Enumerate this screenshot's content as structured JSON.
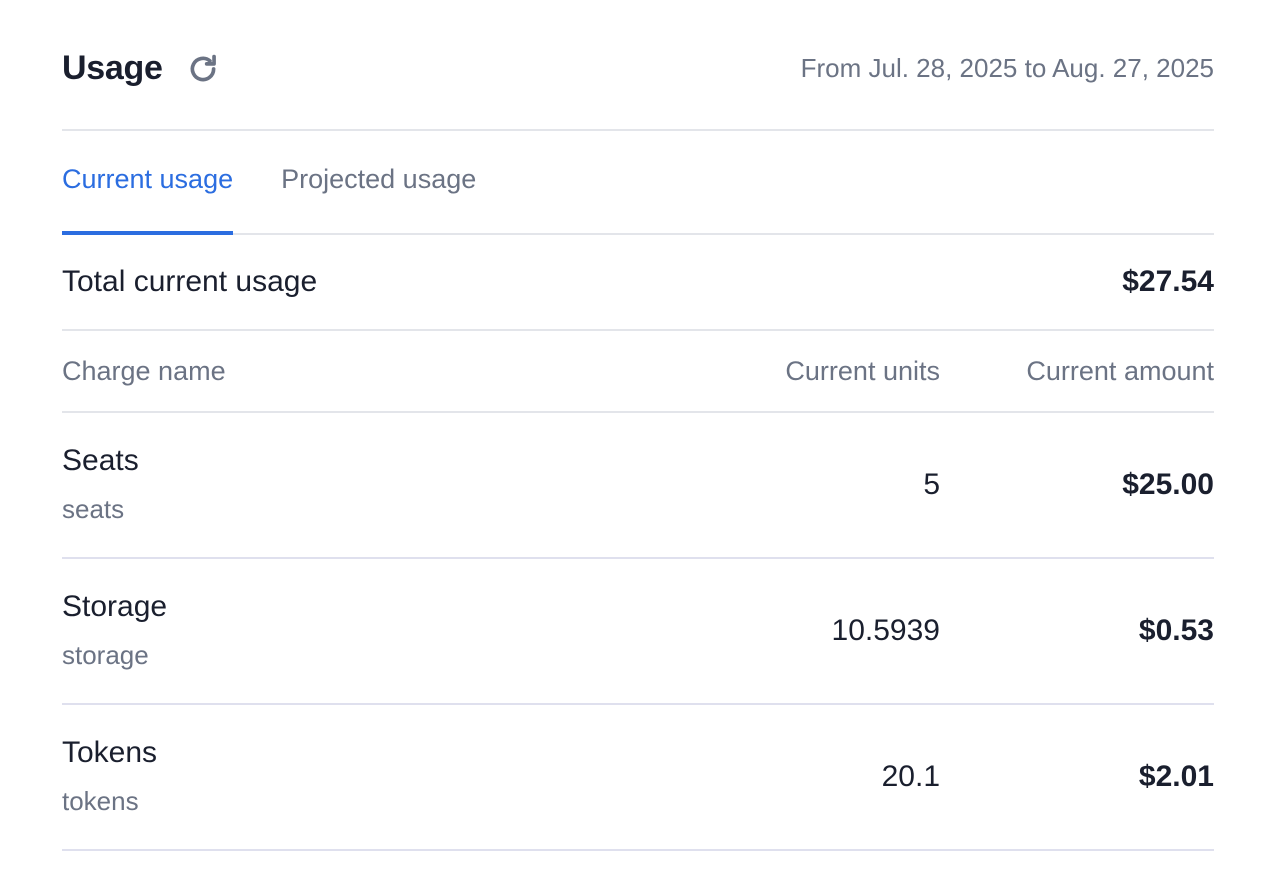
{
  "header": {
    "title": "Usage",
    "refresh_icon": "refresh-icon",
    "date_range": "From Jul. 28, 2025 to Aug. 27, 2025"
  },
  "tabs": [
    {
      "label": "Current usage",
      "active": true
    },
    {
      "label": "Projected usage",
      "active": false
    }
  ],
  "total": {
    "label": "Total current usage",
    "value": "$27.54"
  },
  "table": {
    "columns": [
      "Charge name",
      "Current units",
      "Current amount"
    ],
    "rows": [
      {
        "name": "Seats",
        "code": "seats",
        "units": "5",
        "amount": "$25.00"
      },
      {
        "name": "Storage",
        "code": "storage",
        "units": "10.5939",
        "amount": "$0.53"
      },
      {
        "name": "Tokens",
        "code": "tokens",
        "units": "20.1",
        "amount": "$2.01"
      }
    ]
  },
  "colors": {
    "accent": "#2b6de0",
    "text": "#1a1f2e",
    "muted": "#6b7384",
    "divider": "#e3e5ea"
  }
}
